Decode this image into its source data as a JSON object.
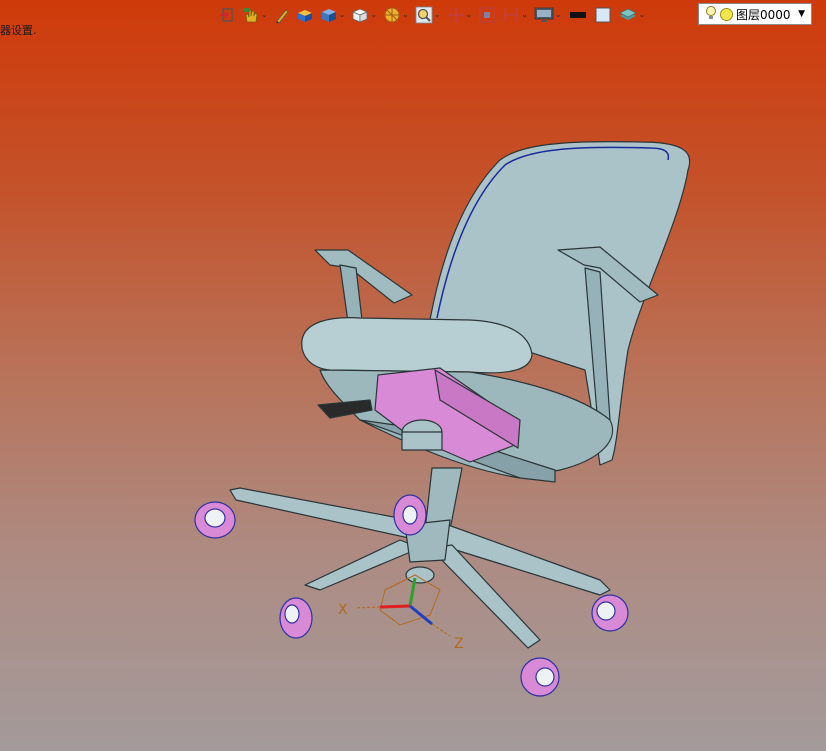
{
  "status": {
    "text": "器设置."
  },
  "toolbar": {
    "tools": [
      {
        "name": "exit-icon"
      },
      {
        "name": "hand-select-icon",
        "dropdown": true
      },
      {
        "name": "pen-icon"
      },
      {
        "name": "shaded-box-icon"
      },
      {
        "name": "view-cube-icon",
        "dropdown": true
      },
      {
        "name": "wire-cube-icon",
        "dropdown": true
      },
      {
        "name": "render-style-icon",
        "dropdown": true
      },
      {
        "name": "zoom-icon",
        "dropdown": true
      },
      {
        "name": "move-icon",
        "dropdown": true
      },
      {
        "name": "frame-icon"
      },
      {
        "name": "section-icon",
        "dropdown": true
      },
      {
        "name": "monitor-icon",
        "dropdown": true
      },
      {
        "name": "black-line-icon"
      },
      {
        "name": "blank-color-icon"
      },
      {
        "name": "layer-stack-icon",
        "dropdown": true
      }
    ],
    "colors": {
      "accent_blue": "#2f6fd0",
      "accent_yellow": "#e0b020",
      "dark": "#202020"
    }
  },
  "layer": {
    "label": "图层0000"
  },
  "axes": {
    "x_label": "X",
    "z_label": "Z"
  },
  "scene": {
    "object": "office-chair",
    "body_color": "#a9c3c8",
    "pink_color": "#d98ad6"
  }
}
